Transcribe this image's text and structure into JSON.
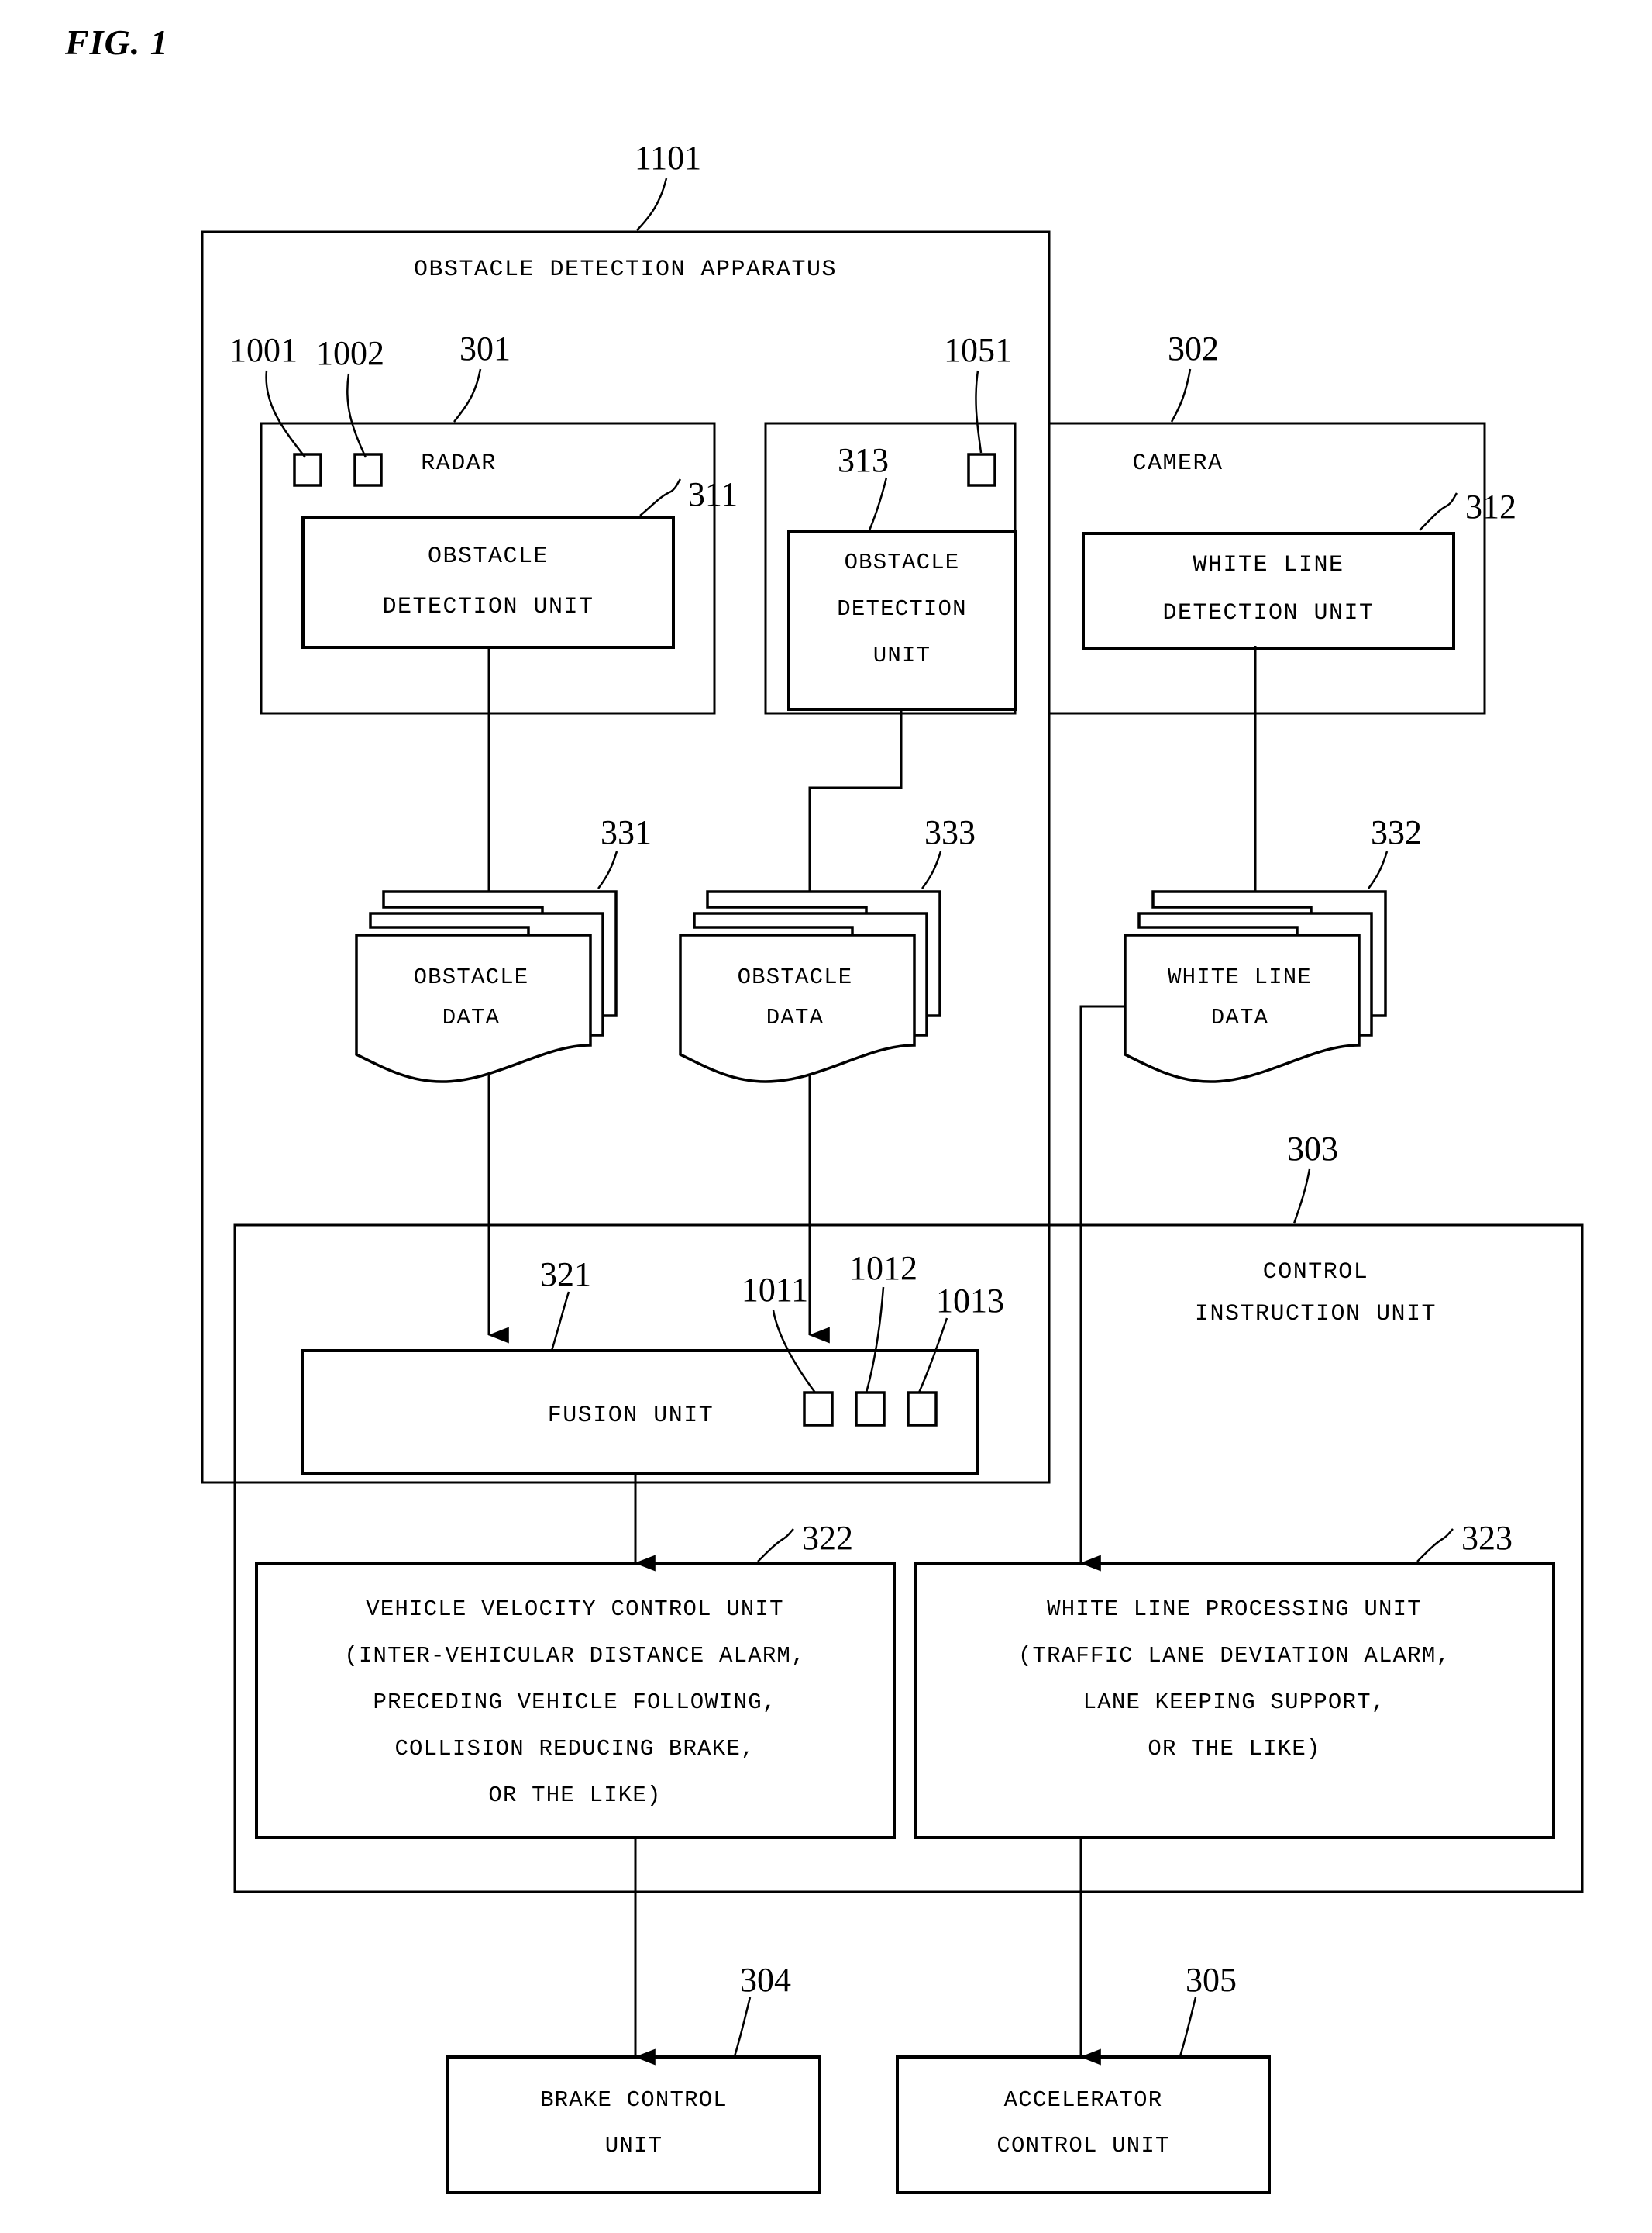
{
  "figure": {
    "title": "FIG. 1"
  },
  "apparatus": {
    "label": "OBSTACLE DETECTION APPARATUS",
    "ref": "1101"
  },
  "radar": {
    "label": "RADAR",
    "ref": "301",
    "ports": [
      {
        "ref": "1001"
      },
      {
        "ref": "1002"
      }
    ],
    "unit": {
      "line1": "OBSTACLE",
      "line2": "DETECTION UNIT",
      "ref": "311"
    }
  },
  "middle": {
    "ref": "1051",
    "unit": {
      "line1": "OBSTACLE",
      "line2": "DETECTION",
      "line3": "UNIT",
      "ref": "313"
    }
  },
  "camera": {
    "label": "CAMERA",
    "ref": "302",
    "unit": {
      "line1": "WHITE LINE",
      "line2": "DETECTION UNIT",
      "ref": "312"
    }
  },
  "data_stores": [
    {
      "line1": "OBSTACLE",
      "line2": "DATA",
      "ref": "331"
    },
    {
      "line1": "OBSTACLE",
      "line2": "DATA",
      "ref": "333"
    },
    {
      "line1": "WHITE LINE",
      "line2": "DATA",
      "ref": "332"
    }
  ],
  "control_instruction_unit": {
    "line1": "CONTROL",
    "line2": "INSTRUCTION UNIT",
    "ref": "303"
  },
  "fusion_unit": {
    "label": "FUSION UNIT",
    "ref": "321",
    "ports": [
      {
        "ref": "1011"
      },
      {
        "ref": "1012"
      },
      {
        "ref": "1013"
      }
    ]
  },
  "vehicle_velocity_control_unit": {
    "ref": "322",
    "lines": [
      "VEHICLE VELOCITY CONTROL UNIT",
      "(INTER-VEHICULAR DISTANCE ALARM,",
      "PRECEDING VEHICLE FOLLOWING,",
      "COLLISION REDUCING BRAKE,",
      "OR THE LIKE)"
    ]
  },
  "white_line_processing_unit": {
    "ref": "323",
    "lines": [
      "WHITE LINE PROCESSING UNIT",
      "(TRAFFIC LANE DEVIATION ALARM,",
      "LANE KEEPING SUPPORT,",
      "OR THE LIKE)"
    ]
  },
  "brake_control_unit": {
    "line1": "BRAKE CONTROL",
    "line2": "UNIT",
    "ref": "304"
  },
  "accelerator_control_unit": {
    "line1": "ACCELERATOR",
    "line2": "CONTROL UNIT",
    "ref": "305"
  }
}
